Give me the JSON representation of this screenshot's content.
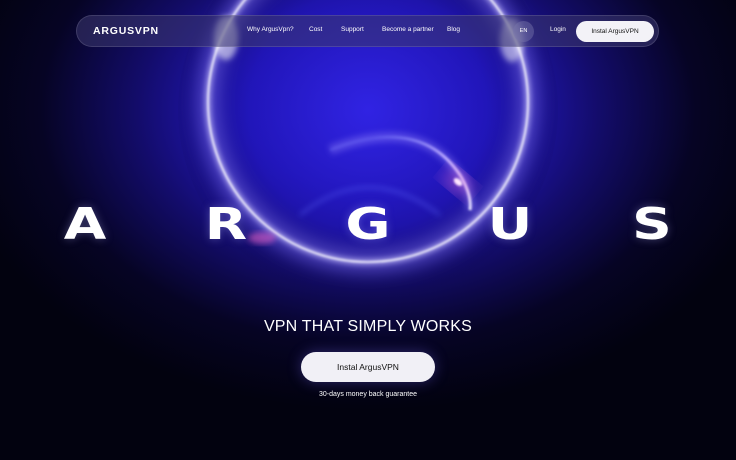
{
  "nav": {
    "logo": "ARGUSVPN",
    "links": [
      {
        "label": "Why ArgusVpn?"
      },
      {
        "label": "Cost"
      },
      {
        "label": "Support"
      },
      {
        "label": "Become a partner"
      },
      {
        "label": "Blog"
      }
    ],
    "language": "EN",
    "login_label": "Login",
    "install_label": "Instal ArgusVPN"
  },
  "hero": {
    "letters": [
      "A",
      "R",
      "G",
      "U",
      "S"
    ],
    "headline": "VPN THAT SIMPLY WORKS",
    "cta_label": "Instal ArgusVPN",
    "guarantee": "30-days money back guarantee"
  },
  "colors": {
    "background": "#02020f",
    "glow_blue": "#2418c8",
    "ring_white": "#ffffff",
    "accent_pink": "#ff7ad6",
    "button_bg": "#f3f2f7"
  }
}
